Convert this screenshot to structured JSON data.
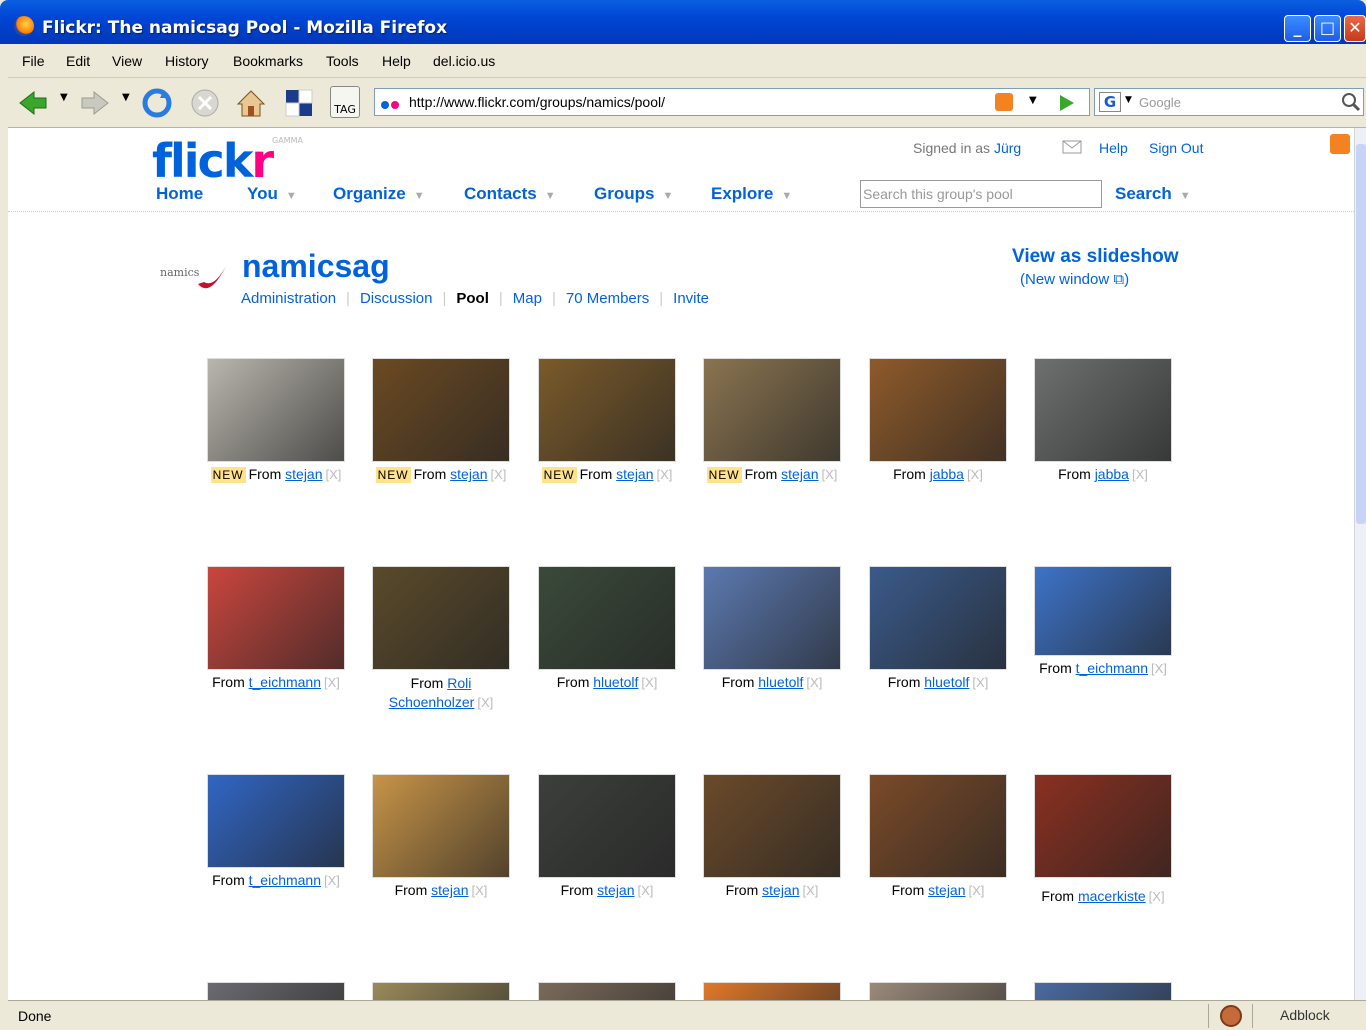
{
  "window": {
    "title": "Flickr: The namicsag Pool - Mozilla Firefox"
  },
  "menu": [
    "File",
    "Edit",
    "View",
    "History",
    "Bookmarks",
    "Tools",
    "Help",
    "del.icio.us"
  ],
  "toolbar": {
    "url": "http://www.flickr.com/groups/namics/pool/",
    "search_placeholder": "Google",
    "tag_label": "TAG"
  },
  "flickr": {
    "logo_a": "flick",
    "logo_b": "r",
    "gamma": "GAMMA",
    "signed_in_prefix": "Signed in as",
    "username": "Jürg",
    "help": "Help",
    "sign_out": "Sign Out",
    "nav": [
      "Home",
      "You",
      "Organize",
      "Contacts",
      "Groups",
      "Explore"
    ],
    "search_placeholder": "Search this group's pool",
    "search_button": "Search"
  },
  "group": {
    "logo_text": "namics",
    "name": "namicsag",
    "tabs": [
      "Administration",
      "Discussion",
      "Pool",
      "Map",
      "70 Members",
      "Invite"
    ],
    "current_tab": "Pool",
    "slideshow": "View as slideshow",
    "new_window": "(New window ⧉)"
  },
  "photos": [
    {
      "new": "NEW",
      "from": "From",
      "user": "stejan",
      "x": "[X]",
      "color": "#b9b6ad"
    },
    {
      "new": "NEW",
      "from": "From",
      "user": "stejan",
      "x": "[X]",
      "color": "#6b4a22"
    },
    {
      "new": "NEW",
      "from": "From",
      "user": "stejan",
      "x": "[X]",
      "color": "#7a5a2a"
    },
    {
      "new": "NEW",
      "from": "From",
      "user": "stejan",
      "x": "[X]",
      "color": "#8a7450"
    },
    {
      "new": "",
      "from": "From",
      "user": "jabba",
      "x": "[X]",
      "color": "#8e5a2a"
    },
    {
      "new": "",
      "from": "From",
      "user": "jabba",
      "x": "[X]",
      "color": "#6e7070"
    },
    {
      "new": "",
      "from": "From",
      "user": "t_eichmann",
      "x": "[X]",
      "color": "#c9463e"
    },
    {
      "new": "",
      "from": "From",
      "user": "Roli Schoenholzer",
      "x": "[X]",
      "color": "#5a4a2a"
    },
    {
      "new": "",
      "from": "From",
      "user": "hluetolf",
      "x": "[X]",
      "color": "#3a4a3a"
    },
    {
      "new": "",
      "from": "From",
      "user": "hluetolf",
      "x": "[X]",
      "color": "#5b79b0"
    },
    {
      "new": "",
      "from": "From",
      "user": "hluetolf",
      "x": "[X]",
      "color": "#3a5a8a"
    },
    {
      "new": "",
      "from": "From",
      "user": "t_eichmann",
      "x": "[X]",
      "color": "#3d73c8"
    },
    {
      "new": "",
      "from": "From",
      "user": "t_eichmann",
      "x": "[X]",
      "color": "#3166c4"
    },
    {
      "new": "",
      "from": "From",
      "user": "stejan",
      "x": "[X]",
      "color": "#c79448"
    },
    {
      "new": "",
      "from": "From",
      "user": "stejan",
      "x": "[X]",
      "color": "#3c3f3c"
    },
    {
      "new": "",
      "from": "From",
      "user": "stejan",
      "x": "[X]",
      "color": "#6b4a2a"
    },
    {
      "new": "",
      "from": "From",
      "user": "stejan",
      "x": "[X]",
      "color": "#7a4a28"
    },
    {
      "new": "",
      "from": "From",
      "user": "macerkiste",
      "x": "[X]",
      "color": "#8a3020"
    }
  ],
  "partial_row_colors": [
    "#6a6a70",
    "#9a8a5a",
    "#7a6a5a",
    "#e0782a",
    "#9a8a7a",
    "#4a6aa0"
  ],
  "status": {
    "done": "Done",
    "adblock": "Adblock"
  }
}
